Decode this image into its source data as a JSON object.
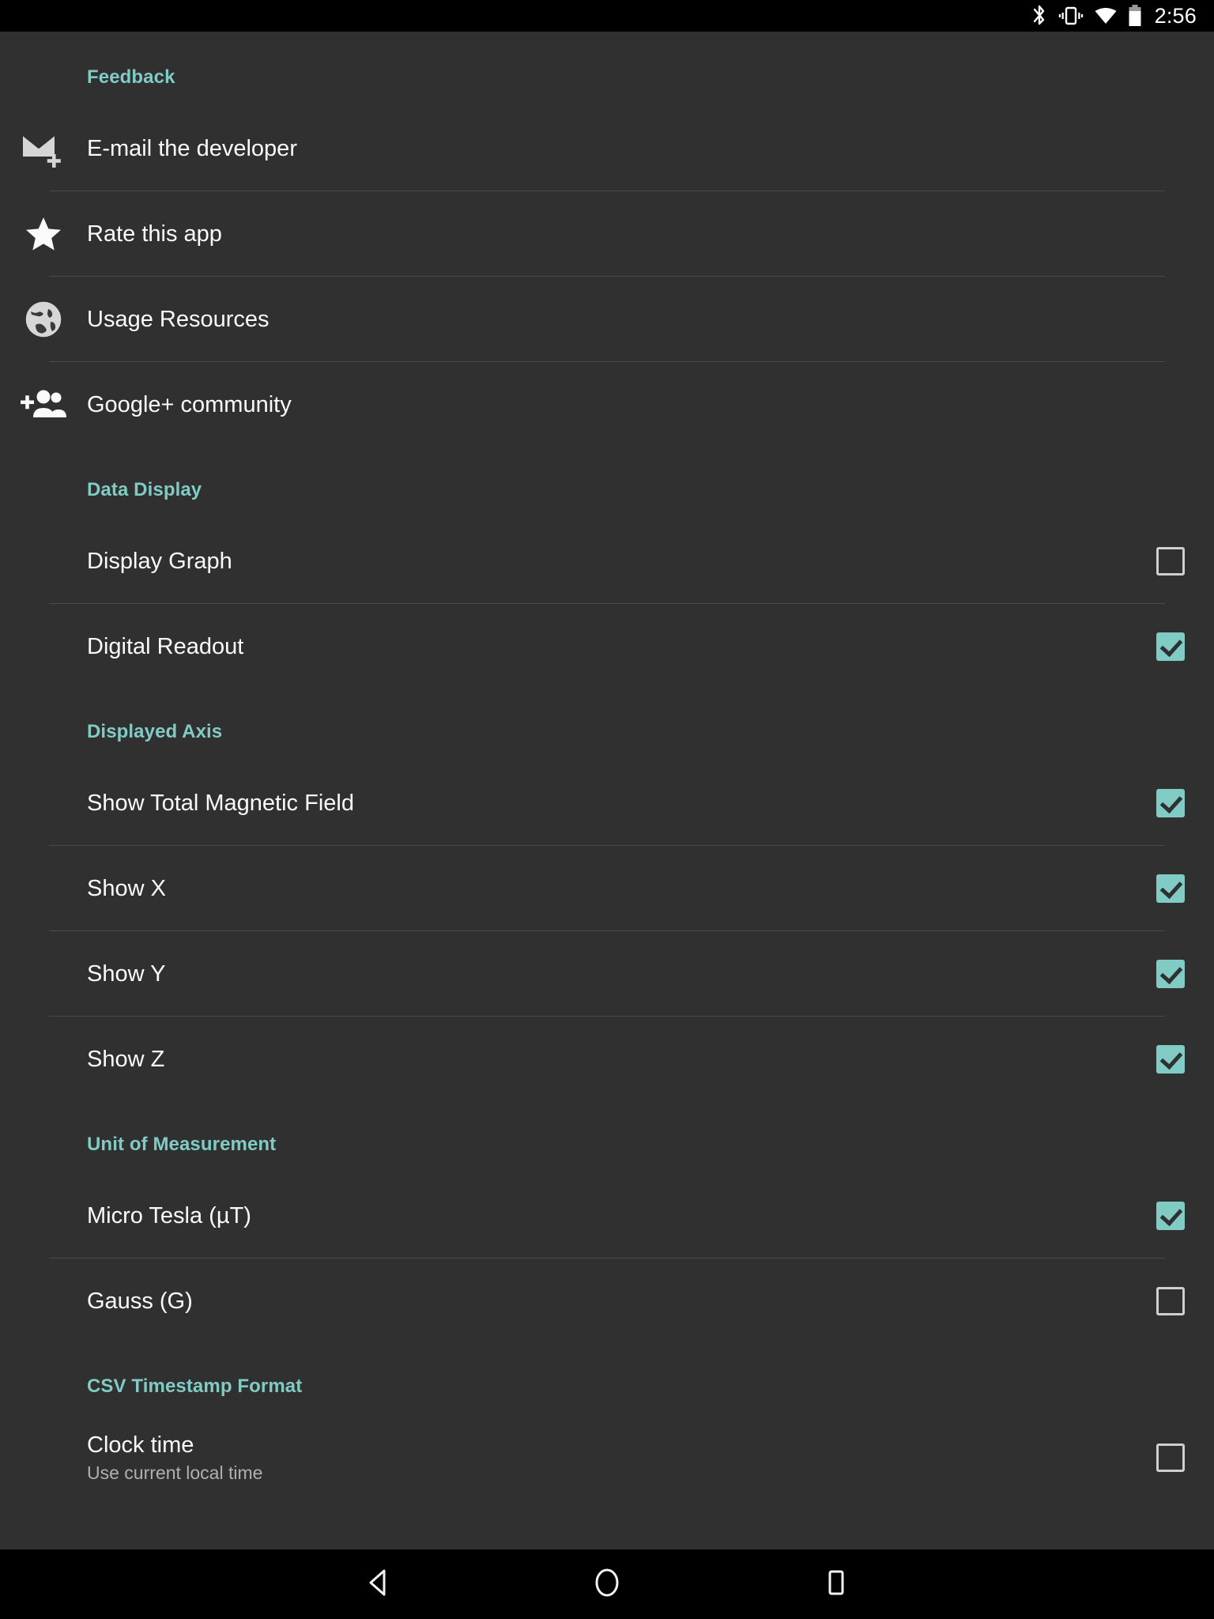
{
  "statusbar": {
    "icons": [
      "bluetooth-icon",
      "vibrate-icon",
      "wifi-icon",
      "battery-icon"
    ],
    "clock": "2:56"
  },
  "accent_color": "#80cbc4",
  "background_color": "#303030",
  "sections": [
    {
      "header": "Feedback",
      "rows": [
        {
          "label": "E-mail the developer",
          "icon": "email-add-icon",
          "type": "icon"
        },
        {
          "label": "Rate this app",
          "icon": "star-icon",
          "type": "icon"
        },
        {
          "label": "Usage Resources",
          "icon": "globe-icon",
          "type": "icon"
        },
        {
          "label": "Google+ community",
          "icon": "person-add-icon",
          "type": "icon"
        }
      ]
    },
    {
      "header": "Data Display",
      "rows": [
        {
          "label": "Display Graph",
          "type": "checkbox",
          "checked": false
        },
        {
          "label": "Digital Readout",
          "type": "checkbox",
          "checked": true
        }
      ]
    },
    {
      "header": "Displayed Axis",
      "rows": [
        {
          "label": "Show Total Magnetic Field",
          "type": "checkbox",
          "checked": true
        },
        {
          "label": "Show X",
          "type": "checkbox",
          "checked": true
        },
        {
          "label": "Show Y",
          "type": "checkbox",
          "checked": true
        },
        {
          "label": "Show Z",
          "type": "checkbox",
          "checked": true
        }
      ]
    },
    {
      "header": "Unit of Measurement",
      "rows": [
        {
          "label": "Micro Tesla (µT)",
          "type": "checkbox",
          "checked": true
        },
        {
          "label": "Gauss (G)",
          "type": "checkbox",
          "checked": false
        }
      ]
    },
    {
      "header": "CSV Timestamp Format",
      "rows": [
        {
          "label": "Clock time",
          "sublabel": "Use current local time",
          "type": "checkbox",
          "checked": false
        }
      ]
    }
  ],
  "navbar": {
    "back": "back-triangle-icon",
    "home": "home-circle-icon",
    "recents": "recents-square-icon"
  }
}
